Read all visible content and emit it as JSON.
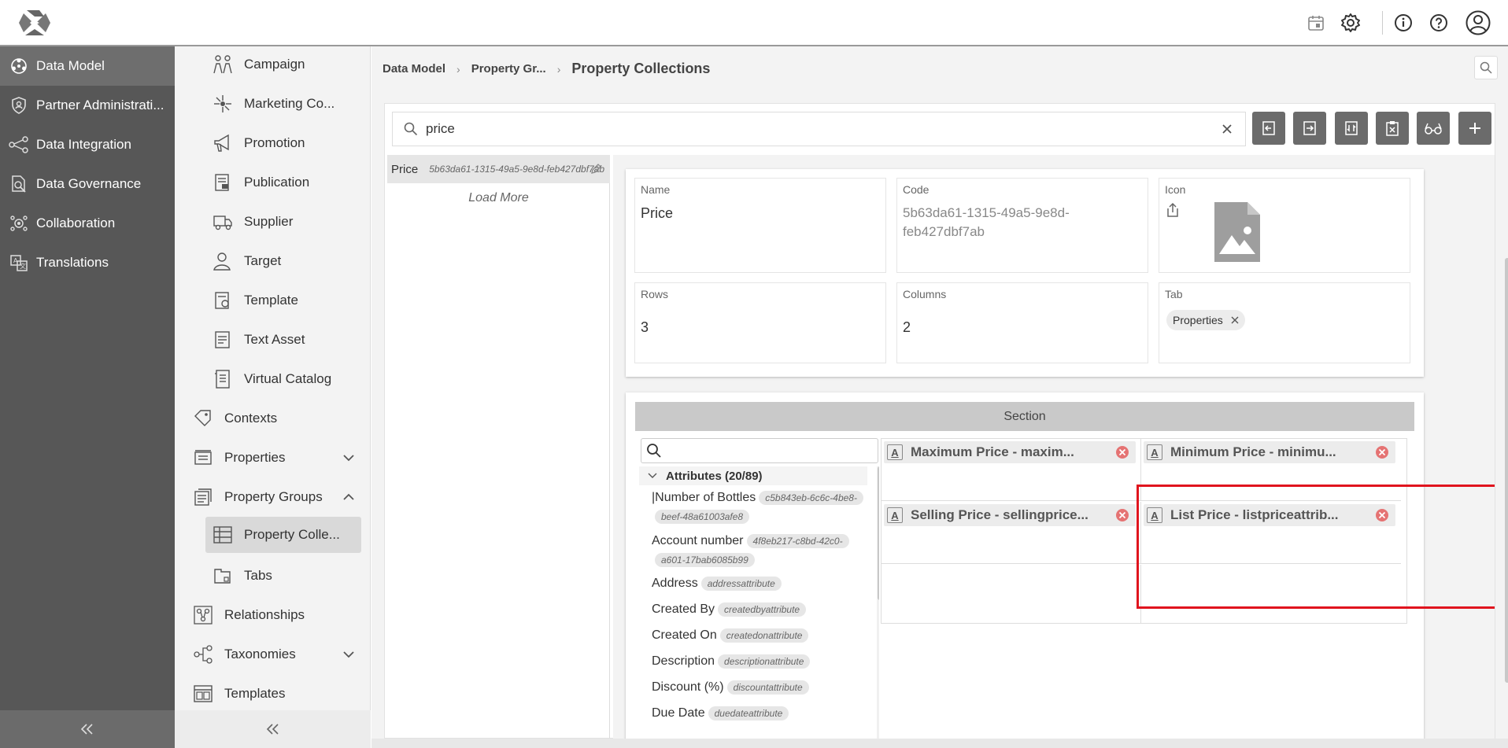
{
  "topbar": {
    "icons": [
      "calendar-icon",
      "gear-icon",
      "info-icon",
      "help-icon",
      "user-avatar-icon"
    ]
  },
  "sidebar": {
    "items": [
      {
        "label": "Data Model",
        "icon": "data-model-icon",
        "active": true
      },
      {
        "label": "Partner Administrati...",
        "icon": "shield-icon"
      },
      {
        "label": "Data Integration",
        "icon": "integration-icon"
      },
      {
        "label": "Data Governance",
        "icon": "governance-icon"
      },
      {
        "label": "Collaboration",
        "icon": "collaboration-icon"
      },
      {
        "label": "Translations",
        "icon": "translations-icon"
      }
    ]
  },
  "subnav": {
    "items": [
      {
        "label": "Campaign",
        "icon": "campaign-icon"
      },
      {
        "label": "Marketing Co...",
        "icon": "marketing-icon"
      },
      {
        "label": "Promotion",
        "icon": "megaphone-icon"
      },
      {
        "label": "Publication",
        "icon": "publication-icon"
      },
      {
        "label": "Supplier",
        "icon": "truck-icon"
      },
      {
        "label": "Target",
        "icon": "target-user-icon"
      },
      {
        "label": "Template",
        "icon": "template-icon"
      },
      {
        "label": "Text Asset",
        "icon": "text-asset-icon"
      },
      {
        "label": "Virtual Catalog",
        "icon": "catalog-icon"
      },
      {
        "label": "Contexts",
        "icon": "tag-icon"
      },
      {
        "label": "Properties",
        "icon": "properties-icon"
      },
      {
        "label": "Property Groups",
        "icon": "property-groups-icon"
      },
      {
        "label": "Property Colle...",
        "icon": "grid-table-icon",
        "active": true
      },
      {
        "label": "Tabs",
        "icon": "tabs-icon"
      },
      {
        "label": "Relationships",
        "icon": "relationships-icon"
      },
      {
        "label": "Taxonomies",
        "icon": "taxonomies-icon"
      },
      {
        "label": "Templates",
        "icon": "templates-icon"
      }
    ]
  },
  "breadcrumb": {
    "items": [
      "Data Model",
      "Property Gr..."
    ],
    "current": "Property Collections"
  },
  "search": {
    "value": "price"
  },
  "toolbar": {
    "buttons": [
      "import-icon",
      "export-icon",
      "sync-icon",
      "delete-clipboard-icon",
      "glasses-icon",
      "plus-icon"
    ]
  },
  "list": {
    "items": [
      {
        "name": "Price",
        "code": "5b63da61-1315-49a5-9e8d-feb427dbf7ab"
      }
    ],
    "load_more": "Load More"
  },
  "detail": {
    "name_label": "Name",
    "name_value": "Price",
    "code_label": "Code",
    "code_value": "5b63da61-1315-49a5-9e8d-feb427dbf7ab",
    "icon_label": "Icon",
    "rows_label": "Rows",
    "rows_value": "3",
    "columns_label": "Columns",
    "columns_value": "2",
    "tab_label": "Tab",
    "tab_chip": "Properties"
  },
  "section": {
    "title": "Section",
    "tree_header": "Attributes (20/89)",
    "attributes": [
      {
        "name": "|Number of Bottles",
        "tag": "c5b843eb-6c6c-4be8-beef-48a61003afe8"
      },
      {
        "name": "Account number",
        "tag": "4f8eb217-c8bd-42c0-a601-17bab6085b99"
      },
      {
        "name": "Address",
        "tag": "addressattribute"
      },
      {
        "name": "Created By",
        "tag": "createdbyattribute"
      },
      {
        "name": "Created On",
        "tag": "createdonattribute"
      },
      {
        "name": "Description",
        "tag": "descriptionattribute"
      },
      {
        "name": "Discount (%)",
        "tag": "discountattribute"
      },
      {
        "name": "Due Date",
        "tag": "duedateattribute"
      }
    ],
    "grid_items": [
      "Maximum Price - maxim...",
      "Minimum Price - minimu...",
      "Selling Price - sellingprice...",
      "List Price - listpriceattrib..."
    ],
    "attr_icon_glyph": "A"
  },
  "colors": {
    "sidebar_bg": "#575757",
    "toolbar_btn": "#6b6b6b",
    "highlight": "#e0141e",
    "remove_icon": "#e57373"
  }
}
